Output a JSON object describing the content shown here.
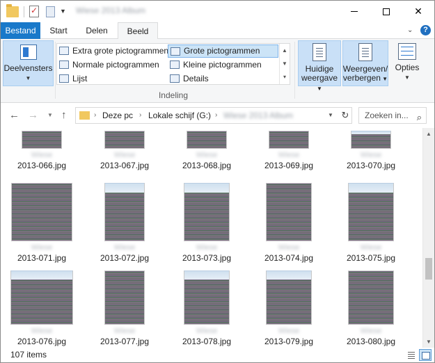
{
  "titlebar": {
    "window_title": "Wiese 2013 Album",
    "minimize_glyph": "—",
    "close_glyph": "✕"
  },
  "ribbon_tabs": {
    "bestand": "Bestand",
    "start": "Start",
    "delen": "Delen",
    "beeld": "Beeld",
    "help": "?"
  },
  "ribbon": {
    "panes": {
      "label": "Deelvensters"
    },
    "layout": {
      "extra_large": "Extra grote pictogrammen",
      "large": "Grote pictogrammen",
      "normal": "Normale pictogrammen",
      "small": "Kleine pictogrammen",
      "list": "Lijst",
      "details": "Details",
      "group_label": "Indeling",
      "selected": "Grote pictogrammen"
    },
    "current_view": {
      "line1": "Huidige",
      "line2": "weergave"
    },
    "show_hide": {
      "line1": "Weergeven/",
      "line2": "verbergen"
    },
    "options": {
      "label": "Opties"
    }
  },
  "addressbar": {
    "crumbs": [
      "Deze pc",
      "Lokale schijf (G:)",
      "Wiese 2013 Album"
    ],
    "search_placeholder": "Zoeken in..."
  },
  "files": [
    {
      "name": "2013-066.jpg",
      "caption": "Wiese"
    },
    {
      "name": "2013-067.jpg",
      "caption": "Wiese"
    },
    {
      "name": "2013-068.jpg",
      "caption": "Wiese"
    },
    {
      "name": "2013-069.jpg",
      "caption": "Wiese"
    },
    {
      "name": "2013-070.jpg",
      "caption": "Wiese"
    },
    {
      "name": "2013-071.jpg",
      "caption": "Wiese"
    },
    {
      "name": "2013-072.jpg",
      "caption": "Wiese"
    },
    {
      "name": "2013-073.jpg",
      "caption": "Wiese"
    },
    {
      "name": "2013-074.jpg",
      "caption": "Wiese"
    },
    {
      "name": "2013-075.jpg",
      "caption": "Wiese"
    },
    {
      "name": "2013-076.jpg",
      "caption": "Wiese"
    },
    {
      "name": "2013-077.jpg",
      "caption": "Wiese"
    },
    {
      "name": "2013-078.jpg",
      "caption": "Wiese"
    },
    {
      "name": "2013-079.jpg",
      "caption": "Wiese"
    },
    {
      "name": "2013-080.jpg",
      "caption": "Wiese"
    }
  ],
  "status": {
    "item_count": "107 items"
  },
  "colors": {
    "accent": "#1979ca",
    "selection": "#cce4f7"
  }
}
